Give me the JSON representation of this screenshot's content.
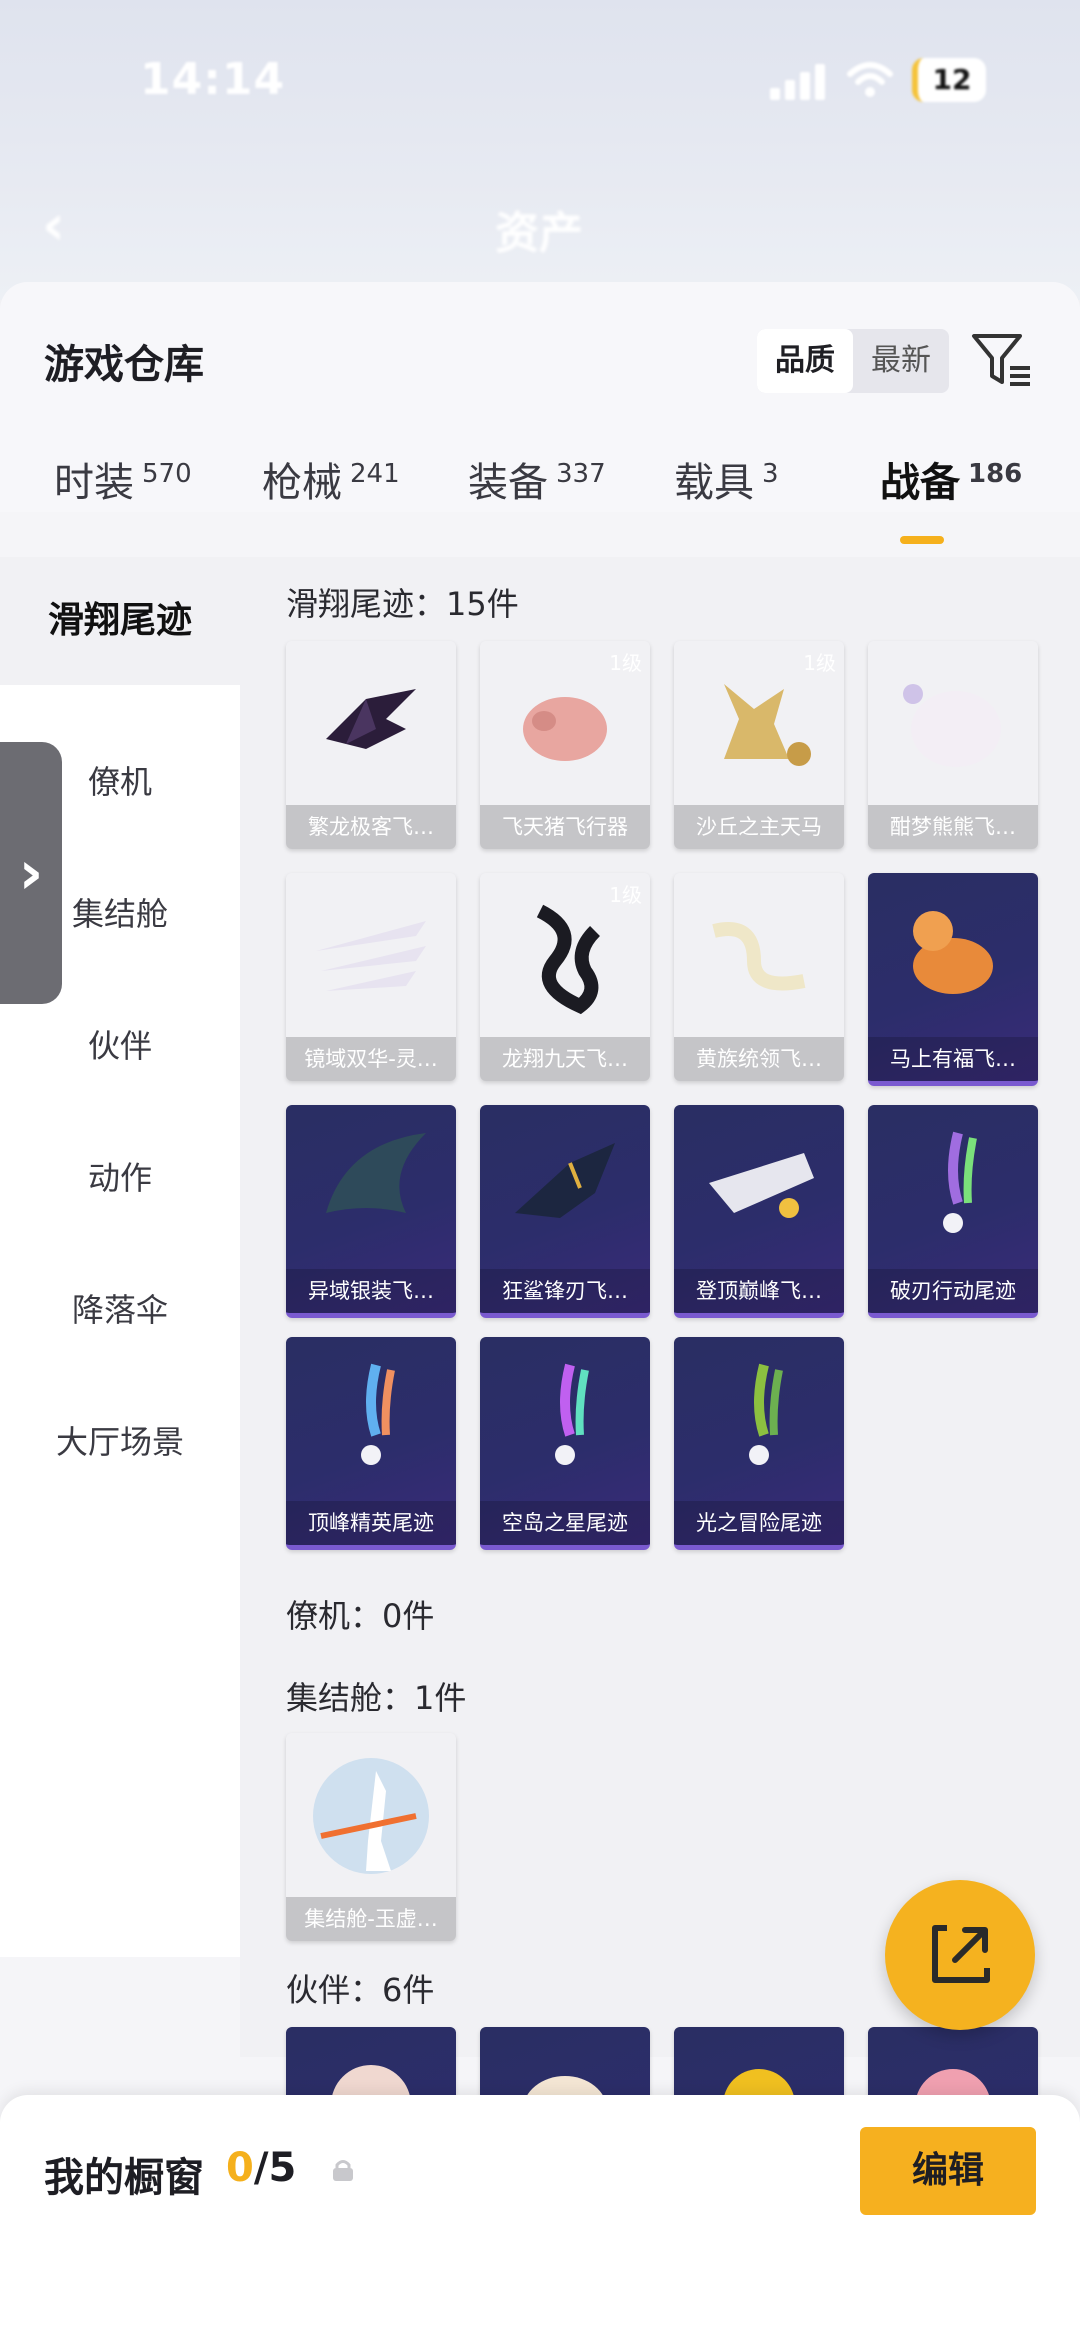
{
  "status": {
    "time": "14:14",
    "battery": "12"
  },
  "nav": {
    "title": "资产"
  },
  "header": {
    "title": "游戏仓库",
    "sort_quality": "品质",
    "sort_newest": "最新"
  },
  "tabs": [
    {
      "label": "时装",
      "count": "570"
    },
    {
      "label": "枪械",
      "count": "241"
    },
    {
      "label": "装备",
      "count": "337"
    },
    {
      "label": "载具",
      "count": "3"
    },
    {
      "label": "战备",
      "count": "186"
    }
  ],
  "sidebar": {
    "items": [
      "滑翔尾迹",
      "僚机",
      "集结舱",
      "伙伴",
      "动作",
      "降落伞",
      "大厅场景"
    ]
  },
  "sections": {
    "glide": {
      "label": "滑翔尾迹：15件"
    },
    "wingman": {
      "label": "僚机：0件"
    },
    "assembly": {
      "label": "集结舱：1件"
    },
    "partner": {
      "label": "伙伴：6件"
    }
  },
  "cards": [
    {
      "name": "繁龙极客飞…",
      "level": "",
      "style": "purple",
      "icon": "dragon-glider-icon"
    },
    {
      "name": "飞天猪飞行器",
      "level": "1级",
      "style": "purple",
      "icon": "flying-pig-icon"
    },
    {
      "name": "沙丘之主天马",
      "level": "1级",
      "style": "purple",
      "icon": "pegasus-icon"
    },
    {
      "name": "酣梦熊熊飞…",
      "level": "",
      "style": "purple",
      "icon": "bear-glider-icon"
    },
    {
      "name": "镜域双华-灵…",
      "level": "",
      "style": "purple",
      "icon": "crystal-wings-icon"
    },
    {
      "name": "龙翔九天飞…",
      "level": "1级",
      "style": "purple",
      "icon": "black-dragon-icon"
    },
    {
      "name": "黄族统领飞…",
      "level": "",
      "style": "purple",
      "icon": "gold-dragon-icon"
    },
    {
      "name": "马上有福飞…",
      "level": "",
      "style": "dark",
      "icon": "horse-toy-icon"
    },
    {
      "name": "异域银装飞…",
      "level": "",
      "style": "dark",
      "icon": "alien-glider-icon"
    },
    {
      "name": "狂鲨锋刃飞…",
      "level": "",
      "style": "dark",
      "icon": "shark-glider-icon"
    },
    {
      "name": "登顶巅峰飞…",
      "level": "",
      "style": "dark",
      "icon": "jet-glider-icon"
    },
    {
      "name": "破刃行动尾迹",
      "level": "",
      "style": "dark",
      "icon": "trail-icon"
    },
    {
      "name": "顶峰精英尾迹",
      "level": "",
      "style": "dark",
      "icon": "trail-icon"
    },
    {
      "name": "空岛之星尾迹",
      "level": "",
      "style": "dark",
      "icon": "trail-icon"
    },
    {
      "name": "光之冒险尾迹",
      "level": "",
      "style": "dark",
      "icon": "trail-icon"
    },
    {
      "name": "集结舱-玉虚…",
      "level": "",
      "style": "purple",
      "icon": "assembly-pod-icon"
    },
    {
      "name": "",
      "level": "",
      "style": "dark",
      "icon": "grandma-partner-icon"
    },
    {
      "name": "",
      "level": "",
      "style": "dark",
      "icon": "hamster-partner-icon"
    },
    {
      "name": "",
      "level": "",
      "style": "dark",
      "icon": "chick-partner-icon"
    },
    {
      "name": "",
      "level": "",
      "style": "dark",
      "icon": "pink-cat-partner-icon"
    }
  ],
  "bottom": {
    "title": "我的橱窗",
    "current": "0",
    "total": "/5",
    "edit_label": "编辑"
  },
  "colors": {
    "accent": "#f5b01c",
    "purple_card": "#8a2fa8",
    "dark_card": "#2c2d6b"
  }
}
